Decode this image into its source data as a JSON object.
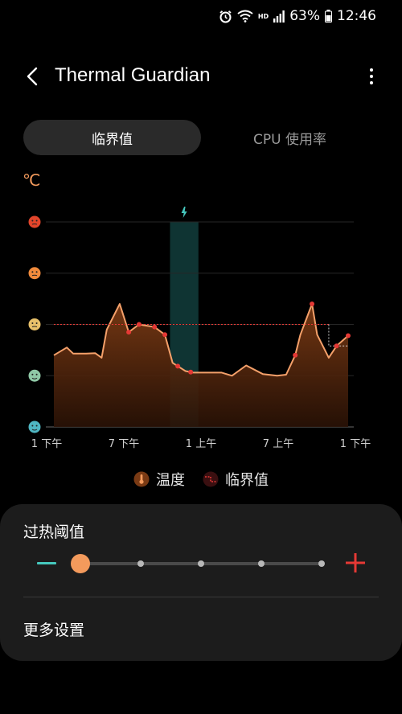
{
  "status_bar": {
    "battery": "63%",
    "time": "12:46",
    "network_badge": "HD",
    "icons": [
      "alarm-icon",
      "wifi-icon",
      "signal-icon",
      "battery-icon"
    ]
  },
  "app_bar": {
    "title": "Thermal Guardian",
    "back_icon": "chevron-left-icon",
    "more_icon": "more-vertical-icon"
  },
  "tabs": [
    {
      "label": "临界值",
      "active": true
    },
    {
      "label": "CPU 使用率",
      "active": false
    }
  ],
  "chart_unit": "℃",
  "chart_data": {
    "type": "area",
    "x_tick_labels": [
      "1 下午",
      "7 下午",
      "1 上午",
      "7 上午",
      "1 下午"
    ],
    "y_levels": [
      "very-hot",
      "hot",
      "warm",
      "normal",
      "cool"
    ],
    "highlight_range": [
      9.0,
      11.2
    ],
    "highlight_icon": "lightning-icon",
    "temperature": {
      "name": "温度",
      "x": [
        0,
        1,
        1.5,
        2,
        2.5,
        3.2,
        3.7,
        4.1,
        5.1,
        5.8,
        6.6,
        7.8,
        8.6,
        9.2,
        10.2,
        10.8,
        11.3,
        12.2,
        13.0,
        13.8,
        14.9,
        16.2,
        17.3,
        18.0,
        18.7,
        19.1,
        20.0,
        20.4,
        21.3,
        21.9,
        22.8
      ],
      "y": [
        1.4,
        1.55,
        1.43,
        1.43,
        1.43,
        1.44,
        1.35,
        1.9,
        2.4,
        1.85,
        2.0,
        1.95,
        1.8,
        1.25,
        1.09,
        1.06,
        1.06,
        1.06,
        1.06,
        1.0,
        1.2,
        1.03,
        1.0,
        1.02,
        1.4,
        1.8,
        2.4,
        1.8,
        1.35,
        1.58,
        1.78
      ]
    },
    "threshold": {
      "name": "临界值",
      "value": 2.0
    },
    "markers_x": [
      5.8,
      6.6,
      7.8,
      8.6,
      9.6,
      10.6,
      18.7,
      20.0,
      21.9,
      22.8
    ]
  },
  "legend": [
    {
      "label": "温度",
      "icon": "thermometer-icon"
    },
    {
      "label": "临界值",
      "icon": "threshold-line-icon"
    }
  ],
  "panel": {
    "title": "过热阈值",
    "slider_value": 0,
    "slider_steps": 5,
    "minus_icon": "minus-icon",
    "plus_icon": "plus-icon",
    "more_settings_label": "更多设置"
  },
  "colors": {
    "accent_orange": "#f39a5c",
    "threshold_red": "#e53935",
    "teal": "#46c8be",
    "highlight_band": "#0f3433"
  }
}
